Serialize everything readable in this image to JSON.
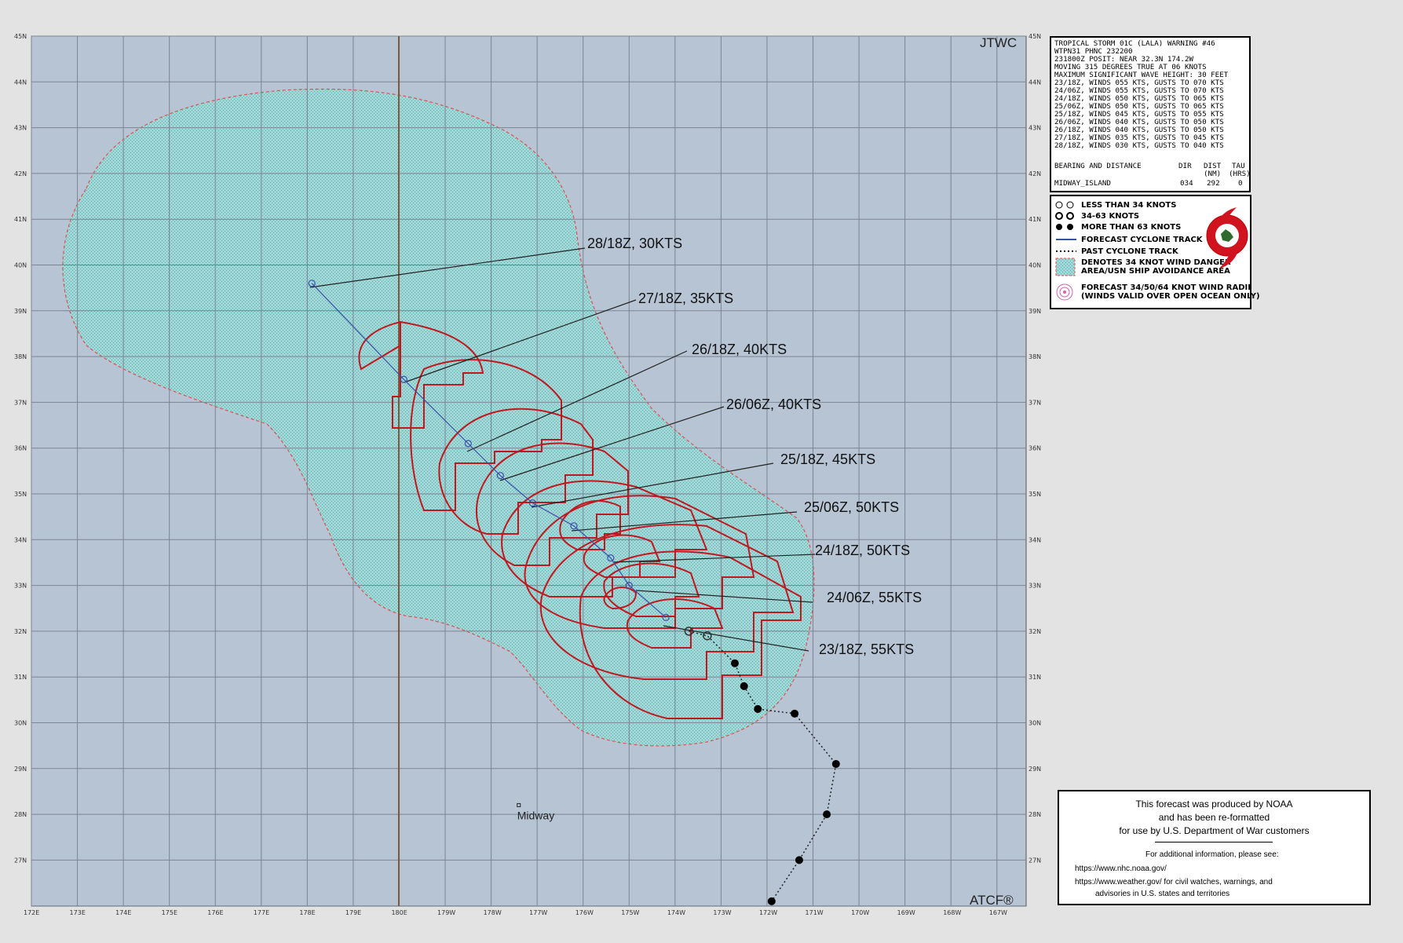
{
  "map": {
    "corner_top": "JTWC",
    "corner_bottom": "ATCF®",
    "lat_labels": [
      "45N",
      "44N",
      "43N",
      "42N",
      "41N",
      "40N",
      "39N",
      "38N",
      "37N",
      "36N",
      "35N",
      "34N",
      "33N",
      "32N",
      "31N",
      "30N",
      "29N",
      "28N",
      "27N"
    ],
    "lon_labels": [
      "172E",
      "173E",
      "174E",
      "175E",
      "176E",
      "177E",
      "178E",
      "179E",
      "180E",
      "179W",
      "178W",
      "177W",
      "176W",
      "175W",
      "174W",
      "173W",
      "172W",
      "171W",
      "170W",
      "169W",
      "168W",
      "167W"
    ],
    "place_label": "Midway",
    "forecast_labels": [
      "28/18Z,  30KTS",
      "27/18Z,  35KTS",
      "26/18Z,  40KTS",
      "26/06Z,  40KTS",
      "25/18Z,  45KTS",
      "25/06Z,  50KTS",
      "24/18Z,  50KTS",
      "24/06Z,  55KTS",
      "23/18Z,  55KTS"
    ],
    "colors": {
      "ocean": "#b7c4d4",
      "grid": "#7b8493",
      "danger_area": "#9fd6d6",
      "wind_radii": "#c0181e",
      "forecast_track": "#3a4fa8",
      "dateline": "#7a5a3a"
    }
  },
  "warning": {
    "lines": [
      "TROPICAL STORM 01C (LALA) WARNING #46",
      "WTPN31 PHNC 232200",
      "231800Z POSIT: NEAR 32.3N 174.2W",
      "MOVING 315 DEGREES TRUE AT 06 KNOTS",
      "MAXIMUM SIGNIFICANT WAVE HEIGHT: 30 FEET",
      "23/18Z, WINDS 055 KTS, GUSTS TO 070 KTS",
      "24/06Z, WINDS 055 KTS, GUSTS TO 070 KTS",
      "24/18Z, WINDS 050 KTS, GUSTS TO 065 KTS",
      "25/06Z, WINDS 050 KTS, GUSTS TO 065 KTS",
      "25/18Z, WINDS 045 KTS, GUSTS TO 055 KTS",
      "26/06Z, WINDS 040 KTS, GUSTS TO 050 KTS",
      "26/18Z, WINDS 040 KTS, GUSTS TO 050 KTS",
      "27/18Z, WINDS 035 KTS, GUSTS TO 045 KTS",
      "28/18Z, WINDS 030 KTS, GUSTS TO 040 KTS"
    ],
    "bearing_header": "BEARING AND DISTANCE",
    "col_dir": "DIR",
    "col_dist": "DIST",
    "col_tau": "TAU",
    "col_dist_unit": "(NM)",
    "col_tau_unit": "(HRS)",
    "row_name": "MIDWAY_ISLAND",
    "row_dir": "034",
    "row_dist": "292",
    "row_tau": "0"
  },
  "legend": {
    "items": [
      "LESS THAN 34 KNOTS",
      "34-63 KNOTS",
      "MORE THAN 63 KNOTS",
      "FORECAST CYCLONE TRACK",
      "PAST CYCLONE TRACK",
      "DENOTES 34 KNOT WIND DANGER",
      "AREA/USN SHIP AVOIDANCE AREA",
      "FORECAST 34/50/64 KNOT WIND RADII",
      "(WINDS VALID OVER OPEN OCEAN ONLY)"
    ]
  },
  "noaa": {
    "line1": "This forecast was produced by NOAA",
    "line2": "and has been re-formatted",
    "line3": "for use by U.S. Department of War customers",
    "info": "For additional information, please see:",
    "url1": "https://www.nhc.noaa.gov/",
    "url2": "https://www.weather.gov/ for civil watches, warnings, and",
    "url2b": "advisories in U.S. states and territories"
  },
  "track": {
    "forecast": [
      {
        "lat": 32.3,
        "lon": -174.2
      },
      {
        "lat": 33.0,
        "lon": -175.0
      },
      {
        "lat": 33.6,
        "lon": -175.4
      },
      {
        "lat": 34.3,
        "lon": -176.2
      },
      {
        "lat": 34.8,
        "lon": -177.1
      },
      {
        "lat": 35.4,
        "lon": -177.8
      },
      {
        "lat": 36.1,
        "lon": -178.5
      },
      {
        "lat": 37.5,
        "lon": -179.9
      },
      {
        "lat": 39.6,
        "lon": 178.1
      }
    ],
    "past": [
      {
        "lat": 32.0,
        "lon": -173.7
      },
      {
        "lat": 31.9,
        "lon": -173.3
      },
      {
        "lat": 31.3,
        "lon": -172.7
      },
      {
        "lat": 30.8,
        "lon": -172.5
      },
      {
        "lat": 30.3,
        "lon": -172.2
      },
      {
        "lat": 30.2,
        "lon": -171.4
      },
      {
        "lat": 29.1,
        "lon": -170.5
      },
      {
        "lat": 28.0,
        "lon": -170.7
      },
      {
        "lat": 27.0,
        "lon": -171.3
      },
      {
        "lat": 26.1,
        "lon": -171.9
      }
    ],
    "midway": {
      "lat": 28.2,
      "lon": -177.4
    }
  }
}
